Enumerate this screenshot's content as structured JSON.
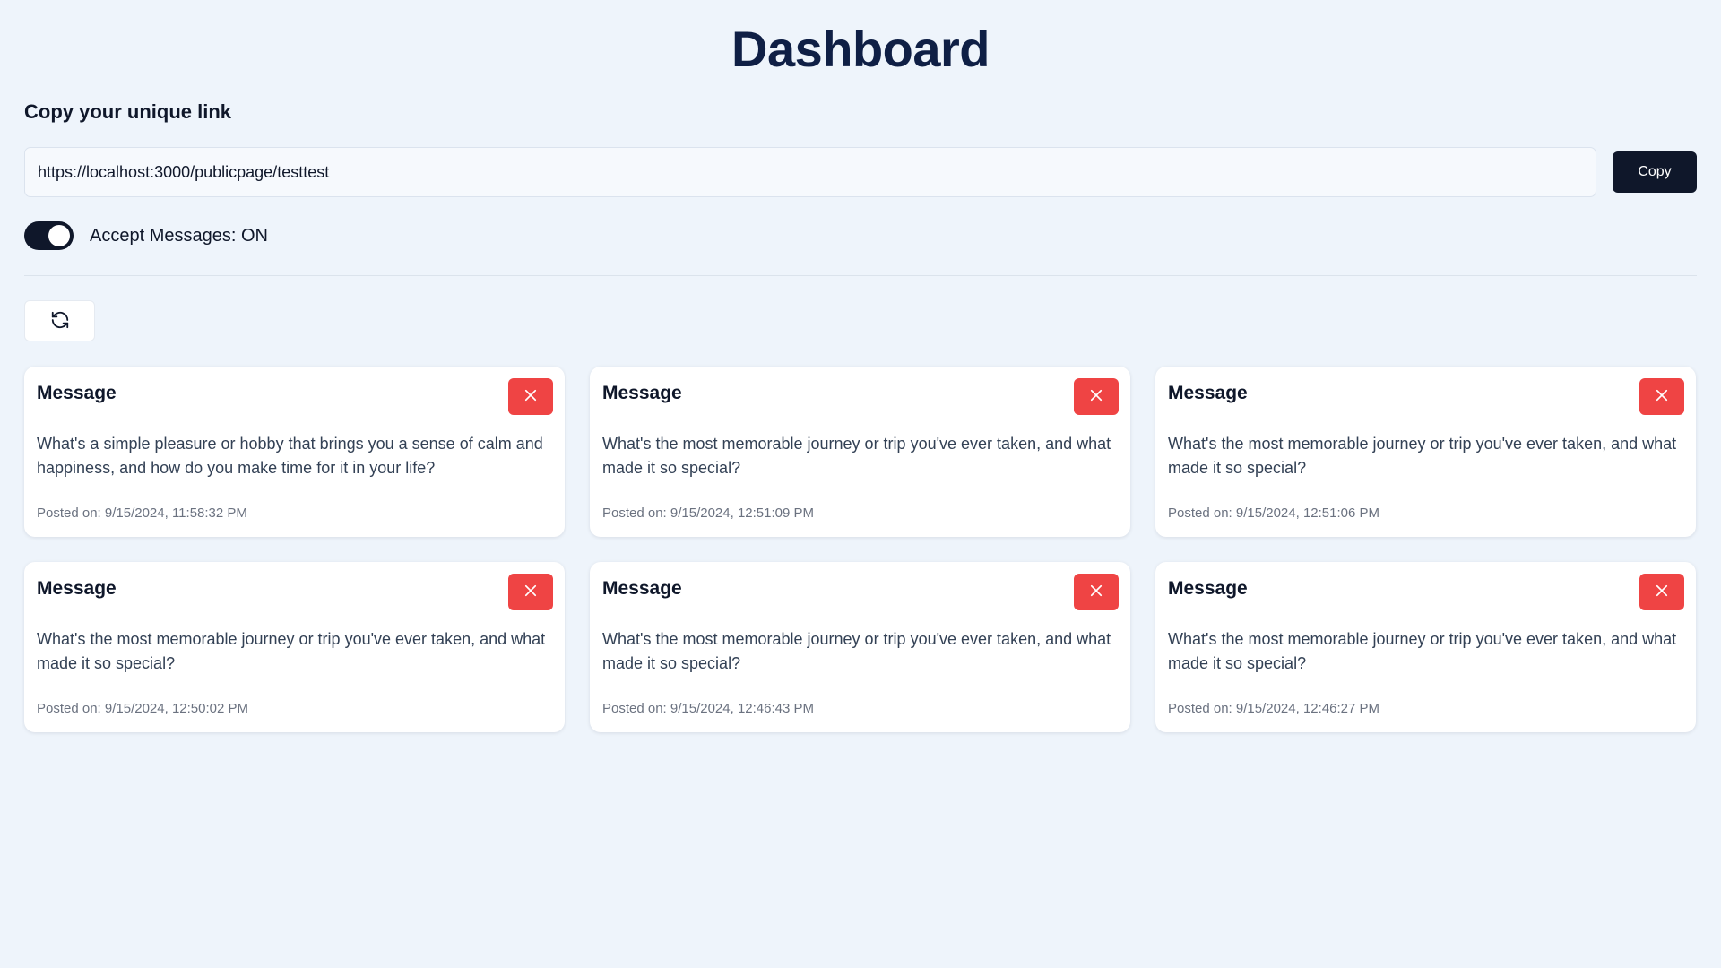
{
  "header": {
    "title": "Dashboard"
  },
  "link_section": {
    "label": "Copy your unique link",
    "url_value": "https://localhost:3000/publicpage/testtest",
    "copy_label": "Copy"
  },
  "toggle": {
    "label": "Accept Messages: ON",
    "state": "on"
  },
  "refresh": {
    "icon": "refresh-icon"
  },
  "messages": [
    {
      "title": "Message",
      "text": "What's a simple pleasure or hobby that brings you a sense of calm and happiness, and how do you make time for it in your life?",
      "date": "Posted on: 9/15/2024, 11:58:32 PM"
    },
    {
      "title": "Message",
      "text": "What's the most memorable journey or trip you've ever taken, and what made it so special?",
      "date": "Posted on: 9/15/2024, 12:51:09 PM"
    },
    {
      "title": "Message",
      "text": "What's the most memorable journey or trip you've ever taken, and what made it so special?",
      "date": "Posted on: 9/15/2024, 12:51:06 PM"
    },
    {
      "title": "Message",
      "text": "What's the most memorable journey or trip you've ever taken, and what made it so special?",
      "date": "Posted on: 9/15/2024, 12:50:02 PM"
    },
    {
      "title": "Message",
      "text": "What's the most memorable journey or trip you've ever taken, and what made it so special?",
      "date": "Posted on: 9/15/2024, 12:46:43 PM"
    },
    {
      "title": "Message",
      "text": "What's the most memorable journey or trip you've ever taken, and what made it so special?",
      "date": "Posted on: 9/15/2024, 12:46:27 PM"
    }
  ],
  "colors": {
    "background": "#eef4fb",
    "primary": "#0f172a",
    "danger": "#ef4444",
    "title": "#0f1f45"
  }
}
